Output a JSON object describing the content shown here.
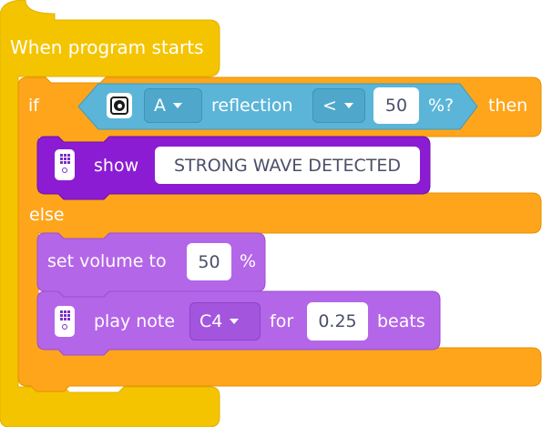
{
  "colors": {
    "events": "#F5C400",
    "control": "#FFA51C",
    "sensor": "#5BB5D8",
    "display": "#8C1CD3",
    "sound": "#B466E8"
  },
  "hat_block": {
    "label": "When program starts"
  },
  "if_block": {
    "if_label": "if",
    "then_label": "then",
    "else_label": "else",
    "condition": {
      "sensor_icon": "color-sensor-icon",
      "port": "A",
      "mode_label": "reflection",
      "operator": "<",
      "value": "50",
      "unit_label": "%?"
    }
  },
  "show_block": {
    "icon": "hub-light-matrix-icon",
    "label": "show",
    "text_value": "STRONG WAVE DETECTED"
  },
  "volume_block": {
    "label": "set volume to",
    "value": "50",
    "unit": "%"
  },
  "note_block": {
    "icon": "hub-speaker-icon",
    "label": "play note",
    "note": "C4",
    "for_label": "for",
    "beats_value": "0.25",
    "beats_label": "beats"
  }
}
